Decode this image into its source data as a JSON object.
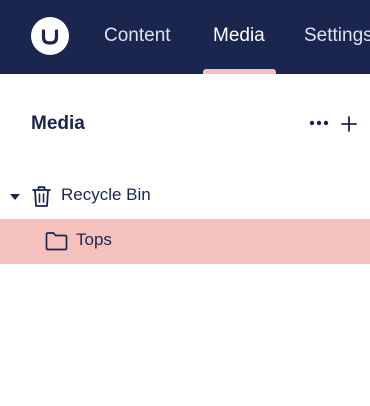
{
  "nav": {
    "tabs": [
      {
        "label": "Content"
      },
      {
        "label": "Media"
      },
      {
        "label": "Settings"
      }
    ],
    "active_tab": "Media"
  },
  "panel": {
    "title": "Media",
    "actions_icon": "ellipsis-icon",
    "add_icon": "plus-icon"
  },
  "tree": {
    "items": [
      {
        "label": "Recycle Bin",
        "icon": "trash-icon",
        "expanded": true
      },
      {
        "label": "Tops",
        "icon": "folder-icon",
        "selected": true
      }
    ]
  },
  "colors": {
    "header_bg": "#1b264f",
    "accent": "#f5c1bc",
    "text": "#1b264f"
  }
}
